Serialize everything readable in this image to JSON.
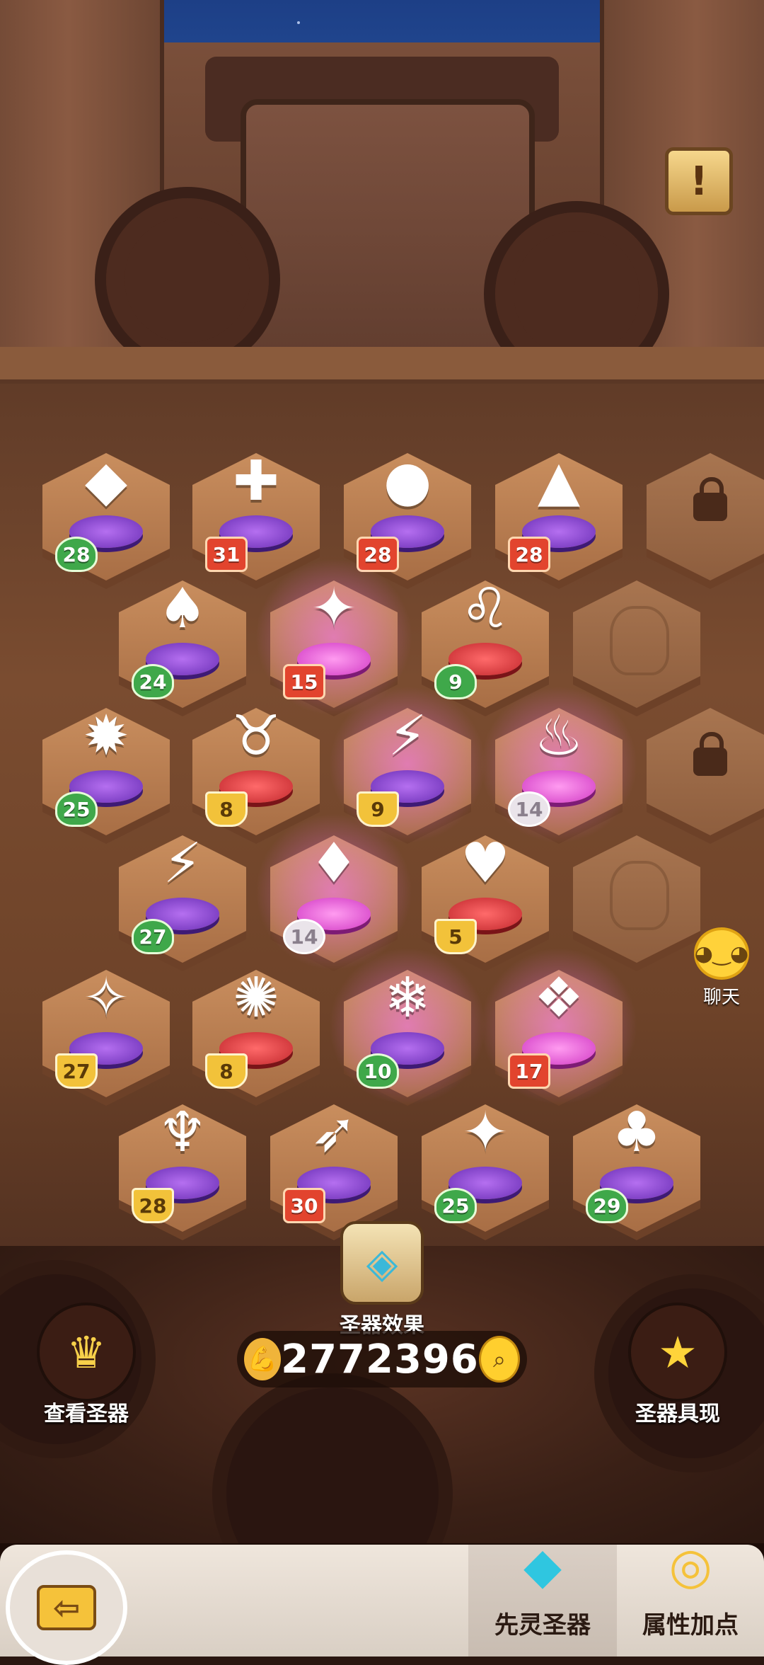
{
  "hud": {
    "info_glyph": "!",
    "chat_label": "聊天",
    "effect_label": "圣器效果",
    "currency_value": "2772396",
    "view_label": "查看圣器",
    "manifest_label": "圣器具现"
  },
  "tabs": [
    {
      "label": "先灵圣器",
      "active": true
    },
    {
      "label": "属性加点",
      "active": false
    }
  ],
  "tiles": [
    {
      "name": "prism-lantern",
      "art": "◆",
      "level": "28",
      "badge": "green",
      "pedestal": "purple"
    },
    {
      "name": "bone-totem",
      "art": "✚",
      "level": "31",
      "badge": "red",
      "pedestal": "purple"
    },
    {
      "name": "orb-statue",
      "art": "●",
      "level": "28",
      "badge": "red",
      "pedestal": "purple"
    },
    {
      "name": "obsidian-spire",
      "art": "▲",
      "level": "28",
      "badge": "red",
      "pedestal": "purple"
    },
    {
      "name": "locked-slot-1",
      "locked": true
    },
    {
      "name": "horned-mask",
      "art": "♠",
      "level": "24",
      "badge": "green",
      "pedestal": "purple"
    },
    {
      "name": "jade-shrine",
      "art": "✦",
      "level": "15",
      "badge": "red",
      "pedestal": "pink",
      "glow": true
    },
    {
      "name": "lion-idol",
      "art": "♌",
      "level": "9",
      "badge": "green",
      "pedestal": "red"
    },
    {
      "name": "empty-monkey-slot-1",
      "ghost": true
    },
    {
      "name": "spell-tome",
      "art": "✹",
      "level": "25",
      "badge": "green",
      "pedestal": "purple"
    },
    {
      "name": "yak-idol",
      "art": "♉",
      "level": "8",
      "badge": "gold",
      "pedestal": "red"
    },
    {
      "name": "crystal-hero",
      "art": "⚡",
      "level": "9",
      "badge": "gold",
      "pedestal": "purple",
      "glow": true
    },
    {
      "name": "flame-tiki",
      "art": "♨",
      "level": "14",
      "badge": "white",
      "pedestal": "pink",
      "glow": true
    },
    {
      "name": "locked-slot-2",
      "locked": true
    },
    {
      "name": "storm-shield",
      "art": "⚡",
      "level": "27",
      "badge": "green",
      "pedestal": "purple"
    },
    {
      "name": "rune-tiki",
      "art": "♦",
      "level": "14",
      "badge": "white",
      "pedestal": "pink",
      "glow": true
    },
    {
      "name": "monkey-idol",
      "art": "♥",
      "level": "5",
      "badge": "gold",
      "pedestal": "red"
    },
    {
      "name": "empty-monkey-slot-2",
      "ghost": true
    },
    {
      "name": "sky-gem-sword",
      "art": "✧",
      "level": "27",
      "badge": "gold",
      "pedestal": "purple"
    },
    {
      "name": "spiked-shell",
      "art": "✺",
      "level": "8",
      "badge": "gold",
      "pedestal": "red"
    },
    {
      "name": "ice-vampire",
      "art": "❄",
      "level": "10",
      "badge": "green",
      "pedestal": "purple",
      "glow": true
    },
    {
      "name": "crystal-shard",
      "art": "❖",
      "level": "17",
      "badge": "red",
      "pedestal": "pink",
      "glow": true
    },
    {
      "name": "trident-crown",
      "art": "♆",
      "level": "28",
      "badge": "gold",
      "pedestal": "purple"
    },
    {
      "name": "ash-blade",
      "art": "➶",
      "level": "30",
      "badge": "red",
      "pedestal": "purple"
    },
    {
      "name": "ice-cube-gem",
      "art": "✦",
      "level": "25",
      "badge": "green",
      "pedestal": "purple"
    },
    {
      "name": "crimson-claw",
      "art": "♣",
      "level": "29",
      "badge": "green",
      "pedestal": "purple"
    }
  ]
}
